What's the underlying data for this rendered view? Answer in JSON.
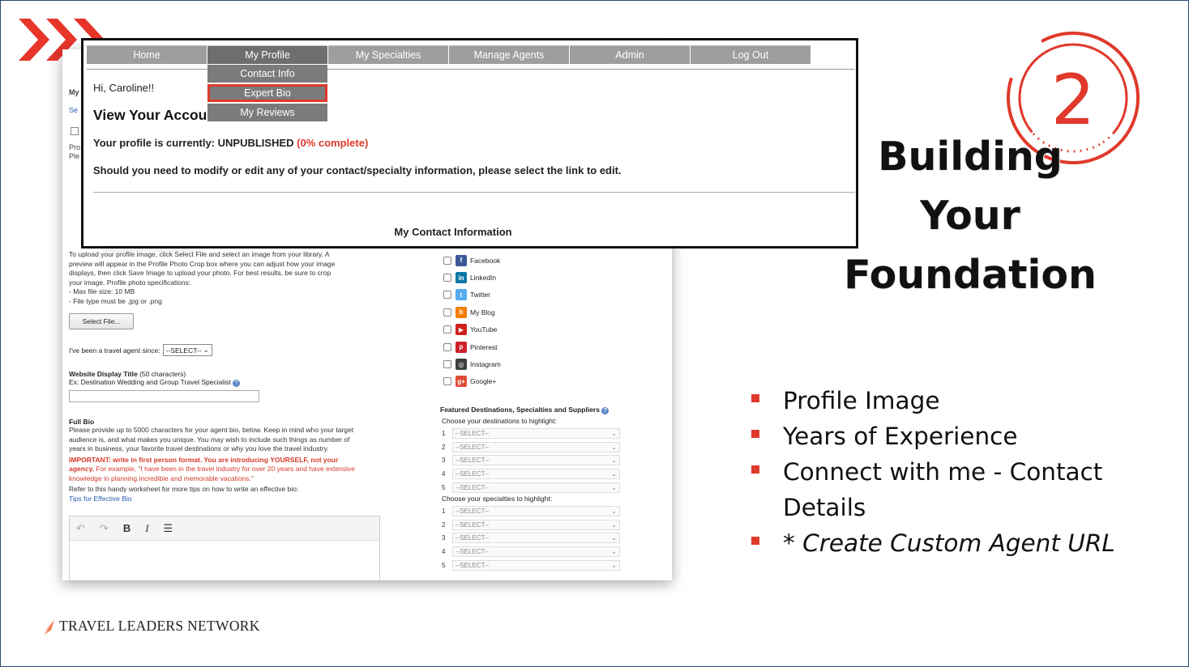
{
  "badge": {
    "number": "2"
  },
  "title_lines": [
    "Building",
    "Your",
    "Foundation"
  ],
  "bullets": [
    {
      "text": "Profile Image"
    },
    {
      "text": "Years of Experience"
    },
    {
      "text": "Connect with me - Contact Details"
    },
    {
      "text": "* Create Custom Agent URL"
    }
  ],
  "logo": {
    "text": "TRAVEL LEADERS NETWORK"
  },
  "colors": {
    "accent": "#e0392b",
    "nav_gray": "#9e9e9e",
    "nav_active": "#6e6e6e",
    "link_blue": "#2a5db0"
  },
  "nav": {
    "items": [
      "Home",
      "My Profile",
      "My Specialties",
      "Manage Agents",
      "Admin",
      "Log Out"
    ],
    "dropdown": [
      "Contact Info",
      "Expert Bio",
      "My Reviews"
    ]
  },
  "profile": {
    "greeting": "Hi, Caroline!!",
    "heading": "View Your Accou",
    "status_prefix": "Your profile is currently: UNPUBLISHED",
    "status_pct": "(0% complete)",
    "modify_text": "Should you need to modify or edit any of your contact/specialty information, please select the link to edit.",
    "contact_heading": "My Contact Information"
  },
  "back": {
    "strip": [
      "My",
      "Se",
      "Pro",
      "Ple"
    ],
    "upload_text": "To upload your profile image, click Select File and select an image from your library. A preview will appear in the Profile Photo Crop box where you can adjust how your image displays, then click Save Image to upload your photo. For best results, be sure to crop your image. Profile photo specifications:",
    "upload_spec1": "- Max file size: 10 MB",
    "upload_spec2": "- File type must be .jpg or .png",
    "select_file": "Select File...",
    "agent_since": "I've been a travel agent since:",
    "select_placeholder": "--SELECT--",
    "wdt_label": "Website Display Title",
    "wdt_chars": "(50 characters)",
    "wdt_example": "Ex: Destination Wedding and Group Travel Specialist",
    "fullbio_title": "Full Bio",
    "fullbio_text": "Please provide up to 5000 characters for your agent bio, below. Keep in mind who your target audience is, and what makes you unique. You may wish to include such things as number of years in business, your favorite travel destinations or why you love the travel industry.",
    "important_bold": "IMPORTANT: write in first person format. You are introducing YOURSELF, not your agency.",
    "important_rest": "For example, \"I have been in the travel industry for over 20 years and have extensive knowledge in planning incredible and memorable vacations.\"",
    "refer_text": "Refer to this handy worksheet for more tips on how to write an effective bio:",
    "tips_link": "Tips for Effective Bio",
    "socials": [
      {
        "label": "Facebook",
        "color": "#3b5998",
        "glyph": "f"
      },
      {
        "label": "LinkedIn",
        "color": "#0e76a8",
        "glyph": "in"
      },
      {
        "label": "Twitter",
        "color": "#55acee",
        "glyph": "t"
      },
      {
        "label": "My Blog",
        "color": "#f57d00",
        "glyph": "b"
      },
      {
        "label": "YouTube",
        "color": "#cd201f",
        "glyph": "▶"
      },
      {
        "label": "Pinterest",
        "color": "#cb2027",
        "glyph": "p"
      },
      {
        "label": "Instagram",
        "color": "#3f3f3f",
        "glyph": "◎"
      },
      {
        "label": "Google+",
        "color": "#dd4b39",
        "glyph": "g+"
      }
    ],
    "featured_title": "Featured Destinations, Specialties and Suppliers",
    "dest_sub": "Choose your destinations to highlight:",
    "spec_sub": "Choose your specialties to highlight:",
    "dest_rows": [
      "1",
      "2",
      "3",
      "4",
      "5"
    ],
    "spec_rows": [
      "1",
      "2",
      "3",
      "4",
      "5"
    ],
    "row_placeholder": "--SELECT--"
  }
}
